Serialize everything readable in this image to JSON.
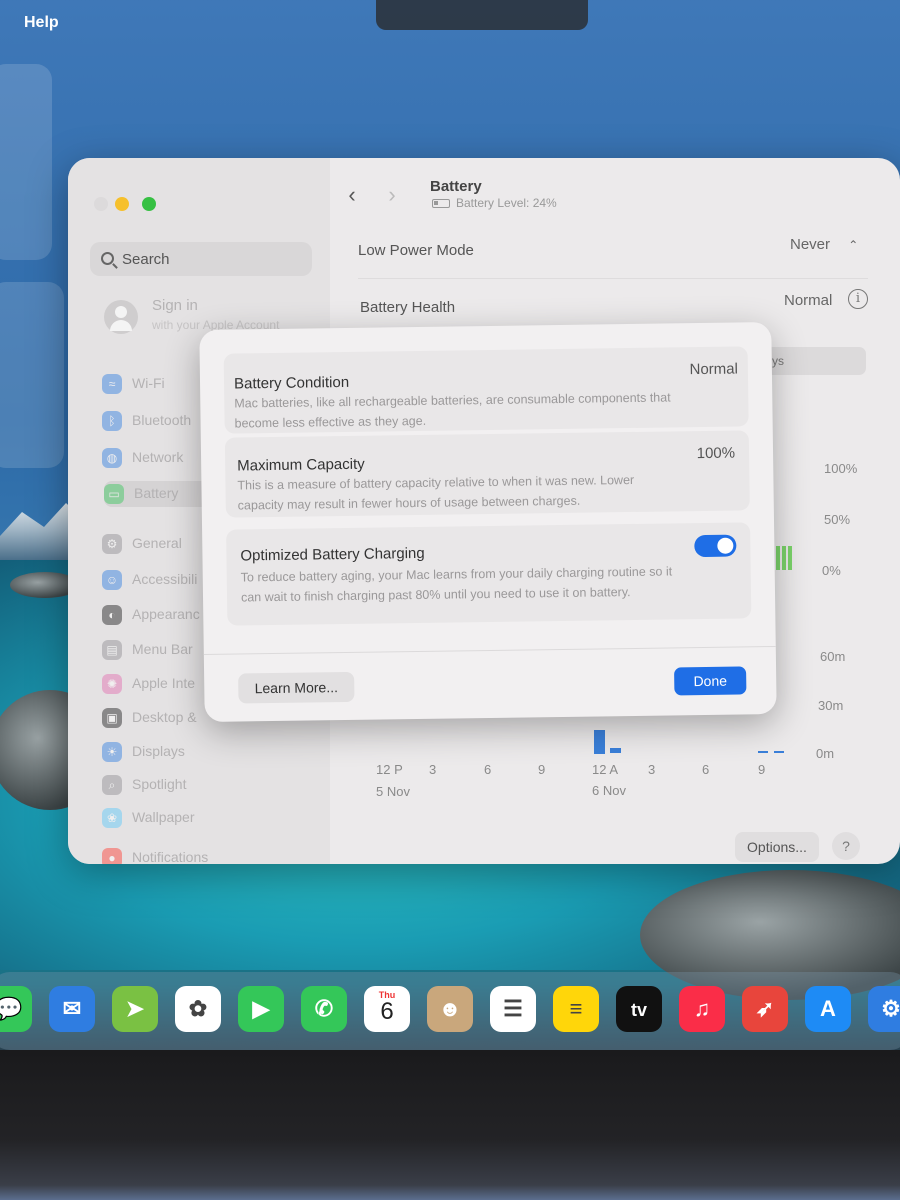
{
  "menubar": {
    "help": "Help"
  },
  "window": {
    "title": "Battery",
    "subtitle": "Battery Level: 24%",
    "search_placeholder": "Search",
    "signin": {
      "title": "Sign in",
      "subtitle": "with your Apple Account"
    },
    "sidebar": {
      "items": [
        {
          "label": "Wi-Fi",
          "icon": "wifi-icon",
          "color": "#2f7de1"
        },
        {
          "label": "Bluetooth",
          "icon": "bluetooth-icon",
          "color": "#2f7de1"
        },
        {
          "label": "Network",
          "icon": "globe-icon",
          "color": "#2f7de1"
        },
        {
          "label": "Battery",
          "icon": "battery-icon",
          "color": "#34c759"
        },
        {
          "label": "General",
          "icon": "gear-icon",
          "color": "#8e8e93"
        },
        {
          "label": "Accessibili",
          "icon": "accessibility-icon",
          "color": "#2f7de1"
        },
        {
          "label": "Appearanc",
          "icon": "appearance-icon",
          "color": "#1c1c1e"
        },
        {
          "label": "Menu Bar",
          "icon": "menubar-icon",
          "color": "#8e8e93"
        },
        {
          "label": "Apple Inte",
          "icon": "apple-intelligence-icon",
          "color": "#e26bb0"
        },
        {
          "label": "Desktop &",
          "icon": "desktop-icon",
          "color": "#1c1c1e"
        },
        {
          "label": "Displays",
          "icon": "displays-icon",
          "color": "#2f7de1"
        },
        {
          "label": "Spotlight",
          "icon": "spotlight-icon",
          "color": "#8e8e93"
        },
        {
          "label": "Wallpaper",
          "icon": "wallpaper-icon",
          "color": "#5ac8fa"
        },
        {
          "label": "Notifications",
          "icon": "notifications-icon",
          "color": "#ff3b30"
        }
      ]
    },
    "rows": {
      "low_power_label": "Low Power Mode",
      "low_power_value": "Never",
      "health_label": "Battery Health",
      "health_value": "Normal",
      "partial_tab": "ys"
    },
    "chart_axis": {
      "level_ticks": [
        "100%",
        "50%",
        "0%"
      ],
      "usage_ticks": [
        "60m",
        "30m",
        "0m"
      ],
      "x_ticks": [
        "12 P",
        "3",
        "6",
        "9",
        "12 A",
        "3",
        "6",
        "9"
      ],
      "dates": [
        "5 Nov",
        "6 Nov"
      ]
    },
    "options_label": "Options...",
    "help_label": "?"
  },
  "modal": {
    "condition": {
      "title": "Battery Condition",
      "value": "Normal",
      "description": "Mac batteries, like all rechargeable batteries, are consumable components that become less effective as they age."
    },
    "capacity": {
      "title": "Maximum Capacity",
      "value": "100%",
      "description": "This is a measure of battery capacity relative to when it was new. Lower capacity may result in fewer hours of usage between charges."
    },
    "optimized": {
      "title": "Optimized Battery Charging",
      "enabled": true,
      "description": "To reduce battery aging, your Mac learns from your daily charging routine so it can wait to finish charging past 80% until you need to use it on battery."
    },
    "learn_more": "Learn More...",
    "done": "Done"
  },
  "dock": {
    "calendar_day": "Thu",
    "calendar_date": "6",
    "tv_label": "tv",
    "items": [
      {
        "icon": "messages-icon",
        "color": "#34c759"
      },
      {
        "icon": "mail-icon",
        "color": "#2f7de1"
      },
      {
        "icon": "maps-icon",
        "color": "#7ac143"
      },
      {
        "icon": "photos-icon",
        "color": "#ffffff"
      },
      {
        "icon": "facetime-icon",
        "color": "#34c759"
      },
      {
        "icon": "phone-icon",
        "color": "#34c759"
      },
      {
        "icon": "calendar-icon",
        "color": "#ffffff"
      },
      {
        "icon": "contacts-icon",
        "color": "#c9a77c"
      },
      {
        "icon": "reminders-icon",
        "color": "#ffffff"
      },
      {
        "icon": "notes-icon",
        "color": "#ffd60a"
      },
      {
        "icon": "tv-icon",
        "color": "#111111"
      },
      {
        "icon": "music-icon",
        "color": "#fa2d48"
      },
      {
        "icon": "launchpad-icon",
        "color": "#e8453c"
      },
      {
        "icon": "app-store-icon",
        "color": "#1e8bf5"
      },
      {
        "icon": "system-settings-icon",
        "color": "#2f7de1"
      }
    ]
  }
}
